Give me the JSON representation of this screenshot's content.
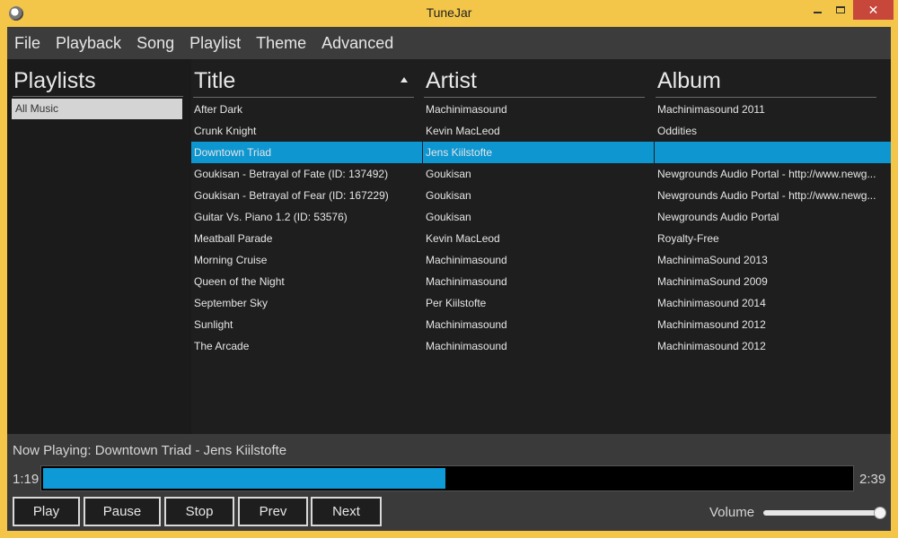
{
  "window": {
    "title": "TuneJar",
    "close_glyph": "✕"
  },
  "menu": [
    "File",
    "Playback",
    "Song",
    "Playlist",
    "Theme",
    "Advanced"
  ],
  "sidebar": {
    "title": "Playlists",
    "items": [
      "All Music"
    ]
  },
  "table": {
    "headers": {
      "title": "Title",
      "artist": "Artist",
      "album": "Album"
    },
    "sort": {
      "column": "title",
      "direction": "ascending"
    },
    "selected_index": 2,
    "rows": [
      {
        "title": "After Dark",
        "artist": "Machinimasound",
        "album": "Machinimasound 2011"
      },
      {
        "title": "Crunk Knight",
        "artist": "Kevin MacLeod",
        "album": "Oddities"
      },
      {
        "title": "Downtown Triad",
        "artist": "Jens Kiilstofte",
        "album": ""
      },
      {
        "title": "Goukisan - Betrayal of Fate (ID: 137492)",
        "artist": "Goukisan",
        "album": "Newgrounds Audio Portal - http://www.newg..."
      },
      {
        "title": "Goukisan - Betrayal of Fear (ID: 167229)",
        "artist": "Goukisan",
        "album": "Newgrounds Audio Portal - http://www.newg..."
      },
      {
        "title": "Guitar Vs. Piano 1.2 (ID: 53576)",
        "artist": "Goukisan",
        "album": "Newgrounds Audio Portal"
      },
      {
        "title": "Meatball Parade",
        "artist": "Kevin MacLeod",
        "album": "Royalty-Free"
      },
      {
        "title": "Morning Cruise",
        "artist": "Machinimasound",
        "album": "MachinimaSound 2013"
      },
      {
        "title": "Queen of the Night",
        "artist": "Machinimasound",
        "album": "MachinimaSound 2009"
      },
      {
        "title": "September Sky",
        "artist": "Per Kiilstofte",
        "album": "Machinimasound 2014"
      },
      {
        "title": "Sunlight",
        "artist": "Machinimasound",
        "album": "Machinimasound 2012"
      },
      {
        "title": "The Arcade",
        "artist": "Machinimasound",
        "album": "Machinimasound 2012"
      }
    ]
  },
  "player": {
    "now_playing": "Now Playing: Downtown Triad - Jens Kiilstofte",
    "elapsed": "1:19",
    "total": "2:39",
    "progress_fraction": 0.497,
    "buttons": {
      "play": "Play",
      "pause": "Pause",
      "stop": "Stop",
      "prev": "Prev",
      "next": "Next"
    },
    "volume_label": "Volume",
    "volume_fraction": 0.97
  },
  "colors": {
    "accent": "#0d96d0",
    "title_bar": "#f3c649",
    "close_button": "#c7473b"
  }
}
